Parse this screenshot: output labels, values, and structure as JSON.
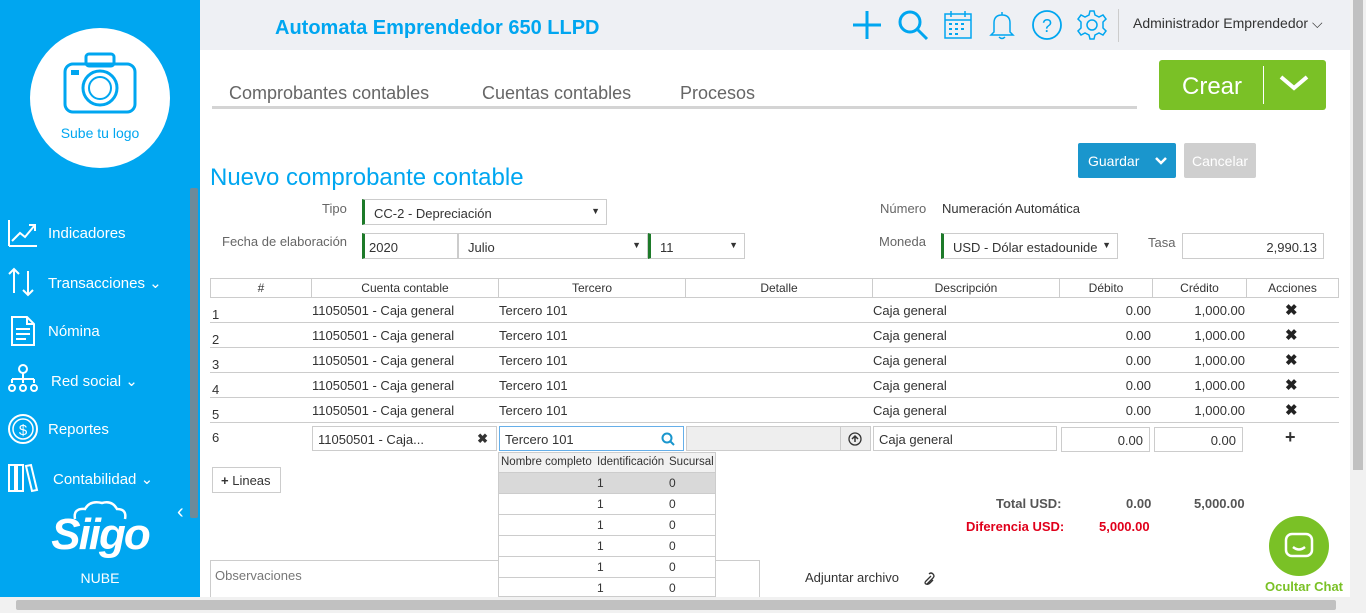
{
  "app": {
    "logo_text": "Sube tu logo",
    "brand": "Siigo",
    "brand_sub": "NUBE",
    "company": "Automata Emprendedor 650 LLPD",
    "user": "Administrador Emprendedor"
  },
  "sidebar": {
    "items": [
      {
        "label": "Indicadores",
        "icon": "chart-icon"
      },
      {
        "label": "Transacciones",
        "icon": "transfer-icon"
      },
      {
        "label": "Nómina",
        "icon": "document-icon"
      },
      {
        "label": "Red social",
        "icon": "network-icon"
      },
      {
        "label": "Reportes",
        "icon": "dollar-icon"
      },
      {
        "label": "Contabilidad",
        "icon": "books-icon"
      }
    ]
  },
  "tabs": [
    "Comprobantes contables",
    "Cuentas contables",
    "Procesos"
  ],
  "buttons": {
    "crear": "Crear",
    "guardar": "Guardar",
    "cancelar": "Cancelar",
    "lineas": "Lineas"
  },
  "form": {
    "title": "Nuevo comprobante contable",
    "tipo_label": "Tipo",
    "tipo_value": "CC-2 - Depreciación",
    "fecha_label": "Fecha de elaboración",
    "year": "2020",
    "month": "Julio",
    "day": "11",
    "numero_label": "Número",
    "numero_value": "Numeración Automática",
    "moneda_label": "Moneda",
    "moneda_value": "USD - Dólar estadounide",
    "tasa_label": "Tasa",
    "tasa_value": "2,990.13"
  },
  "table": {
    "headers": [
      "#",
      "Cuenta contable",
      "Tercero",
      "Detalle",
      "Descripción",
      "Débito",
      "Crédito",
      "Acciones"
    ],
    "rows": [
      {
        "n": "1",
        "cuenta": "11050501 - Caja general",
        "tercero": "Tercero 101",
        "descripcion": "Caja general",
        "debito": "0.00",
        "credito": "1,000.00"
      },
      {
        "n": "2",
        "cuenta": "11050501 - Caja general",
        "tercero": "Tercero 101",
        "descripcion": "Caja general",
        "debito": "0.00",
        "credito": "1,000.00"
      },
      {
        "n": "3",
        "cuenta": "11050501 - Caja general",
        "tercero": "Tercero 101",
        "descripcion": "Caja general",
        "debito": "0.00",
        "credito": "1,000.00"
      },
      {
        "n": "4",
        "cuenta": "11050501 - Caja general",
        "tercero": "Tercero 101",
        "descripcion": "Caja general",
        "debito": "0.00",
        "credito": "1,000.00"
      },
      {
        "n": "5",
        "cuenta": "11050501 - Caja general",
        "tercero": "Tercero 101",
        "descripcion": "Caja general",
        "debito": "0.00",
        "credito": "1,000.00"
      }
    ],
    "edit_row": {
      "n": "6",
      "cuenta": "11050501 - Caja...",
      "tercero": "Tercero 101",
      "descripcion": "Caja general",
      "debito": "0.00",
      "credito": "0.00"
    }
  },
  "dropdown": {
    "headers": [
      "Nombre completo",
      "Identificación",
      "Sucursal"
    ],
    "rows": [
      {
        "id": "1",
        "sucursal": "0"
      },
      {
        "id": "1",
        "sucursal": "0"
      },
      {
        "id": "1",
        "sucursal": "0"
      },
      {
        "id": "1",
        "sucursal": "0"
      },
      {
        "id": "1",
        "sucursal": "0"
      },
      {
        "id": "1",
        "sucursal": "0"
      }
    ]
  },
  "totals": {
    "total_label": "Total USD:",
    "total_debito": "0.00",
    "total_credito": "5,000.00",
    "diff_label": "Diferencia USD:",
    "diff_value": "5,000.00"
  },
  "footer": {
    "observaciones_placeholder": "Observaciones",
    "adjuntar": "Adjuntar archivo",
    "chat": "Ocultar Chat"
  },
  "colors": {
    "brand_blue": "#00a6f0",
    "green": "#7ac126",
    "red": "#e0001b"
  }
}
